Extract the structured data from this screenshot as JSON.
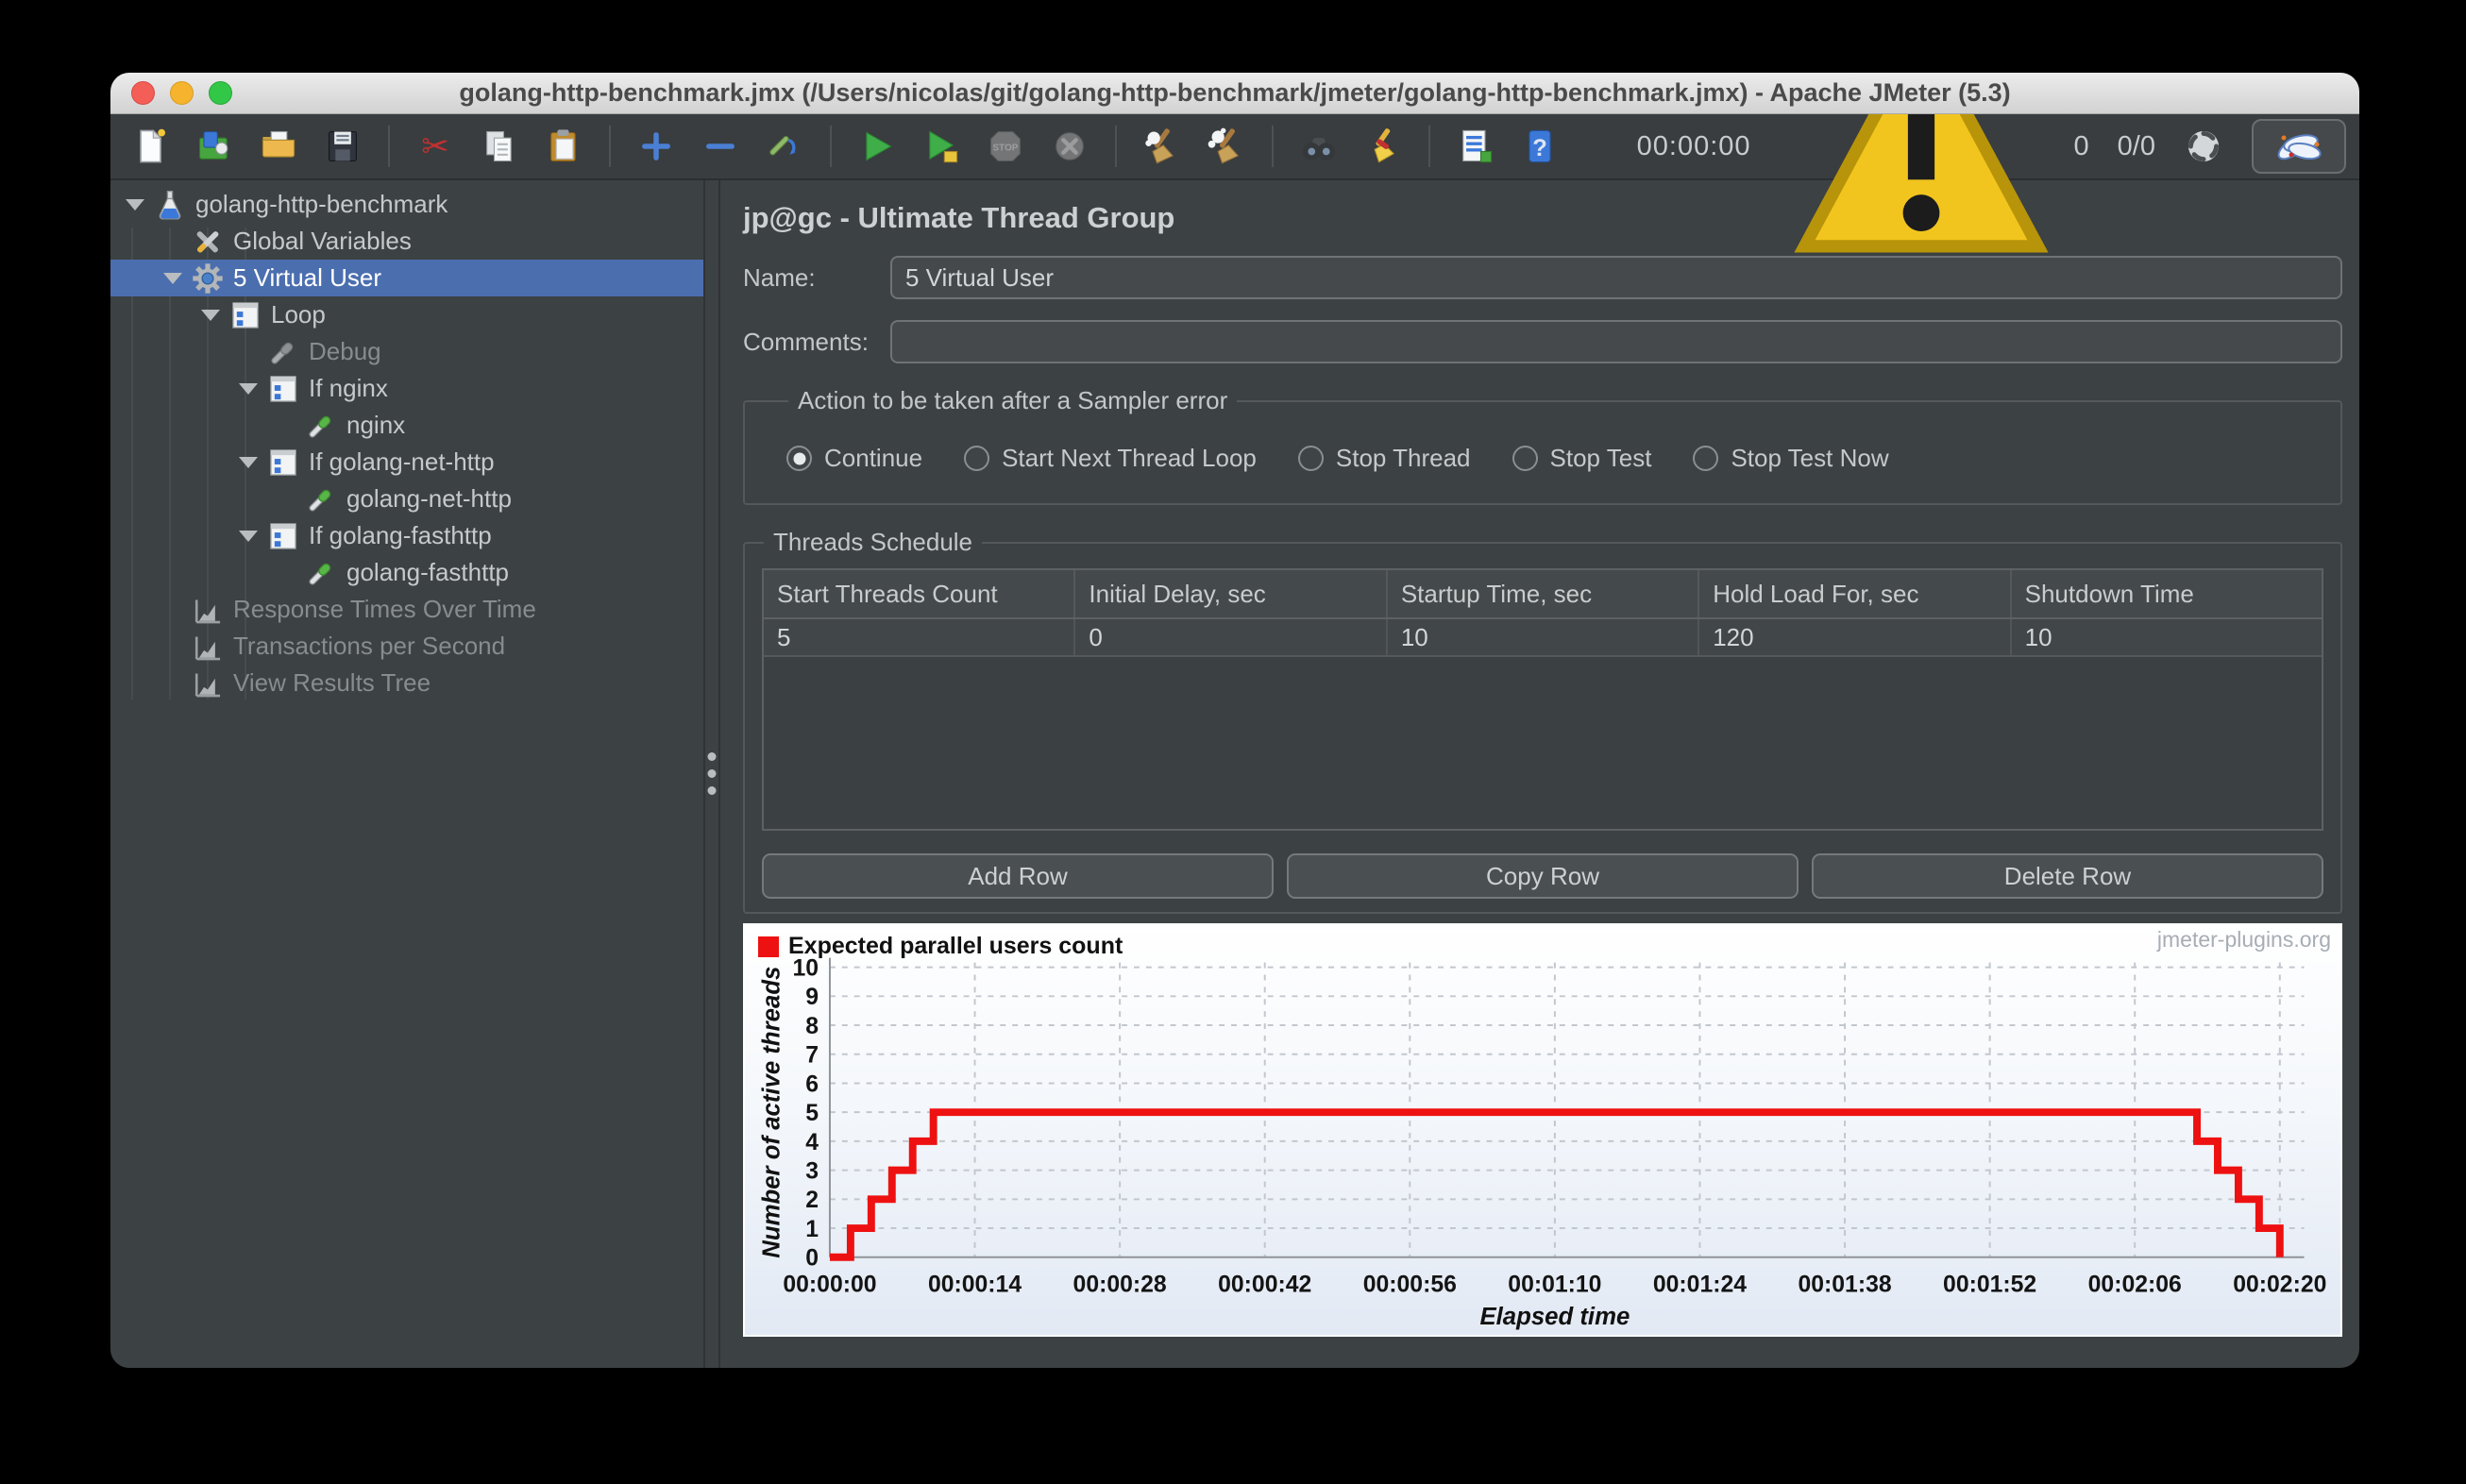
{
  "window": {
    "title": "golang-http-benchmark.jmx (/Users/nicolas/git/golang-http-benchmark/jmeter/golang-http-benchmark.jmx) - Apache JMeter (5.3)"
  },
  "toolbar": {
    "items": [
      {
        "name": "new-file",
        "icon": "new-file"
      },
      {
        "name": "templates",
        "icon": "templates"
      },
      {
        "name": "open-file",
        "icon": "open-folder"
      },
      {
        "name": "save",
        "icon": "save"
      },
      {
        "sep": true
      },
      {
        "name": "cut",
        "icon": "cut"
      },
      {
        "name": "copy",
        "icon": "copy"
      },
      {
        "name": "paste",
        "icon": "paste"
      },
      {
        "sep": true
      },
      {
        "name": "expand-all",
        "icon": "plus"
      },
      {
        "name": "collapse-all",
        "icon": "minus"
      },
      {
        "name": "toggle-enabled",
        "icon": "toggle"
      },
      {
        "sep": true
      },
      {
        "name": "start",
        "icon": "play"
      },
      {
        "name": "start-no-pauses",
        "icon": "play-alt"
      },
      {
        "name": "stop",
        "icon": "stop",
        "disabled": true
      },
      {
        "name": "shutdown",
        "icon": "shutdown",
        "disabled": true
      },
      {
        "sep": true
      },
      {
        "name": "clear",
        "icon": "broom"
      },
      {
        "name": "clear-all",
        "icon": "broom-all"
      },
      {
        "sep": true
      },
      {
        "name": "search",
        "icon": "binoculars"
      },
      {
        "name": "search-reset",
        "icon": "broom-reset"
      },
      {
        "sep": true
      },
      {
        "name": "function-helper",
        "icon": "function"
      },
      {
        "name": "help",
        "icon": "help"
      }
    ],
    "timer": "00:00:00",
    "warning_count": "0",
    "thread_status": "0/0"
  },
  "tree": {
    "items": [
      {
        "label": "golang-http-benchmark",
        "icon": "flask",
        "depth": 0,
        "arrow": true
      },
      {
        "label": "Global Variables",
        "icon": "tools",
        "depth": 1
      },
      {
        "label": "5 Virtual User",
        "icon": "gear",
        "depth": 1,
        "arrow": true,
        "selected": true
      },
      {
        "label": "Loop",
        "icon": "controller",
        "depth": 2,
        "arrow": true
      },
      {
        "label": "Debug",
        "icon": "sampler-off",
        "depth": 3,
        "disabled": true
      },
      {
        "label": "If nginx",
        "icon": "controller",
        "depth": 3,
        "arrow": true
      },
      {
        "label": "nginx",
        "icon": "sampler",
        "depth": 4
      },
      {
        "label": "If golang-net-http",
        "icon": "controller",
        "depth": 3,
        "arrow": true
      },
      {
        "label": "golang-net-http",
        "icon": "sampler",
        "depth": 4
      },
      {
        "label": "If golang-fasthttp",
        "icon": "controller",
        "depth": 3,
        "arrow": true
      },
      {
        "label": "golang-fasthttp",
        "icon": "sampler",
        "depth": 4
      },
      {
        "label": "Response Times Over Time",
        "icon": "chart-listener",
        "depth": 1,
        "disabled": true
      },
      {
        "label": "Transactions per Second",
        "icon": "chart-listener",
        "depth": 1,
        "disabled": true
      },
      {
        "label": "View Results Tree",
        "icon": "chart-listener",
        "depth": 1,
        "disabled": true
      }
    ]
  },
  "main": {
    "title": "jp@gc - Ultimate Thread Group",
    "name_label": "Name:",
    "name_value": "5 Virtual User",
    "comments_label": "Comments:",
    "comments_value": "",
    "action_group": {
      "title": "Action to be taken after a Sampler error",
      "options": [
        {
          "label": "Continue",
          "selected": true
        },
        {
          "label": "Start Next Thread Loop",
          "selected": false
        },
        {
          "label": "Stop Thread",
          "selected": false
        },
        {
          "label": "Stop Test",
          "selected": false
        },
        {
          "label": "Stop Test Now",
          "selected": false
        }
      ]
    },
    "threads_group": {
      "title": "Threads Schedule",
      "columns": [
        "Start Threads Count",
        "Initial Delay, sec",
        "Startup Time, sec",
        "Hold Load For, sec",
        "Shutdown Time"
      ],
      "rows": [
        [
          "5",
          "0",
          "10",
          "120",
          "10"
        ]
      ],
      "buttons": [
        "Add Row",
        "Copy Row",
        "Delete Row"
      ]
    }
  },
  "chart_data": {
    "type": "line",
    "step": true,
    "legend": "Expected parallel users count",
    "series_color": "#ee1111",
    "watermark": "jmeter-plugins.org",
    "ylabel": "Number of active threads",
    "xlabel": "Elapsed time",
    "ylim": [
      0,
      10
    ],
    "y_ticks": [
      0,
      1,
      2,
      3,
      4,
      5,
      6,
      7,
      8,
      9,
      10
    ],
    "x_tick_labels": [
      "00:00:00",
      "00:00:14",
      "00:00:28",
      "00:00:42",
      "00:00:56",
      "00:01:10",
      "00:01:24",
      "00:01:38",
      "00:01:52",
      "00:02:06",
      "00:02:20"
    ],
    "x_tick_seconds": [
      0,
      14,
      28,
      42,
      56,
      70,
      84,
      98,
      112,
      126,
      140
    ],
    "xlim_seconds": [
      0,
      140
    ],
    "points_time_threads": [
      [
        0,
        0
      ],
      [
        2,
        1
      ],
      [
        4,
        2
      ],
      [
        6,
        3
      ],
      [
        8,
        4
      ],
      [
        10,
        5
      ],
      [
        130,
        5
      ],
      [
        132,
        4
      ],
      [
        134,
        3
      ],
      [
        136,
        2
      ],
      [
        138,
        1
      ],
      [
        140,
        0
      ]
    ],
    "grid": true,
    "legend_position": "top-left"
  },
  "colors": {
    "selection": "#4b6eaf",
    "series_red": "#ee1111",
    "accent_blue": "#4a7fd4"
  }
}
